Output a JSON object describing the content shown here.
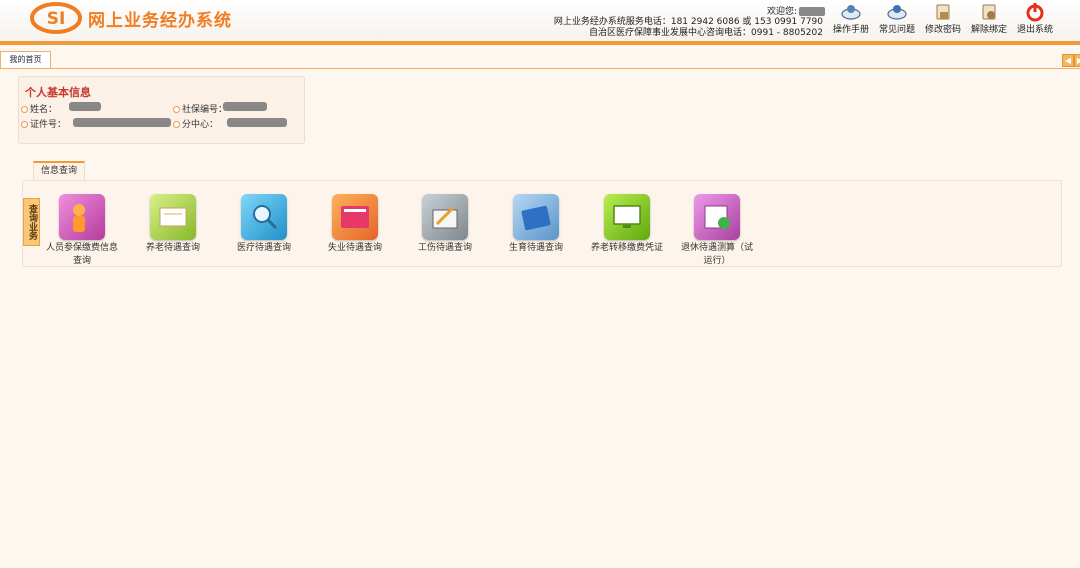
{
  "header": {
    "logo_mark": "SI",
    "app_title": "网上业务经办系统",
    "welcome_label": "欢迎您:",
    "hotline_1": "网上业务经办系统服务电话：181 2942 6086 或 153 0991 7790",
    "hotline_2": "自治区医疗保障事业发展中心咨询电话：0991 - 8805202",
    "toolbar": [
      {
        "label": "操作手册",
        "icon": "manual-icon"
      },
      {
        "label": "常见问题",
        "icon": "faq-icon"
      },
      {
        "label": "修改密码",
        "icon": "change-password-icon"
      },
      {
        "label": "解除绑定",
        "icon": "unbind-icon"
      },
      {
        "label": "退出系统",
        "icon": "power-icon"
      }
    ]
  },
  "tabs": {
    "home": "我的首页",
    "prev": "◀",
    "next": "▶"
  },
  "info": {
    "title": "个人基本信息",
    "name_label": "姓名：",
    "ssn_label": "社保编号：",
    "id_label": "证件号：",
    "branch_label": "分中心："
  },
  "query": {
    "tab_label": "信息查询",
    "side_label": "查询业务",
    "services": [
      {
        "label": "人员参保缴费信息查询",
        "icon": "person-insurance-icon",
        "color": "#d35ab8"
      },
      {
        "label": "养老待遇查询",
        "icon": "pension-icon",
        "color": "#9ccc3c"
      },
      {
        "label": "医疗待遇查询",
        "icon": "medical-search-icon",
        "color": "#27a9e1"
      },
      {
        "label": "失业待遇查询",
        "icon": "unemployment-book-icon",
        "color": "#e97f2c"
      },
      {
        "label": "工伤待遇查询",
        "icon": "injury-icon",
        "color": "#8f989e"
      },
      {
        "label": "生育待遇查询",
        "icon": "maternity-book-icon",
        "color": "#6fa9d6"
      },
      {
        "label": "养老转移缴费凭证",
        "icon": "monitor-icon",
        "color": "#7bc51b"
      },
      {
        "label": "退休待遇测算（试运行）",
        "icon": "retirement-calc-icon",
        "color": "#c158bf"
      }
    ]
  }
}
